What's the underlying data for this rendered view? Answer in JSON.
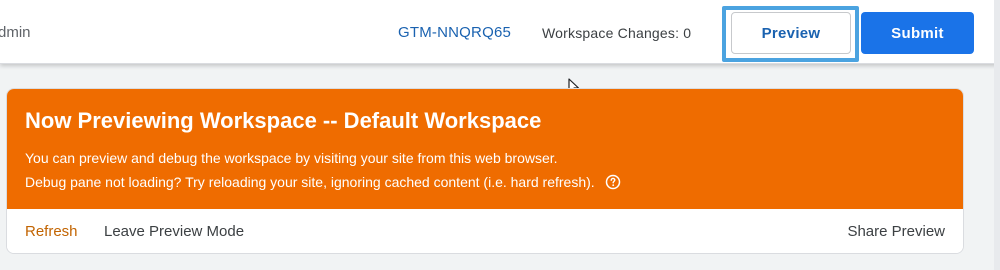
{
  "header": {
    "left_text": "dmin",
    "container_id": "GTM-NNQRQ65",
    "workspace_changes_label": "Workspace Changes:",
    "workspace_changes_count": "0",
    "preview_label": "Preview",
    "submit_label": "Submit"
  },
  "banner": {
    "title": "Now Previewing Workspace -- Default Workspace",
    "line1": "You can preview and debug the workspace by visiting your site from this web browser.",
    "line2": "Debug pane not loading? Try reloading your site, ignoring cached content (i.e. hard refresh).",
    "help_icon": "help-circle-icon",
    "actions": {
      "refresh": "Refresh",
      "leave": "Leave Preview Mode",
      "share": "Share Preview"
    }
  },
  "colors": {
    "banner_orange": "#ef6c00",
    "primary_blue": "#1a73e8",
    "link_blue": "#1a62b0",
    "highlight_blue": "#4ba3e0",
    "refresh_orange": "#c26401"
  }
}
